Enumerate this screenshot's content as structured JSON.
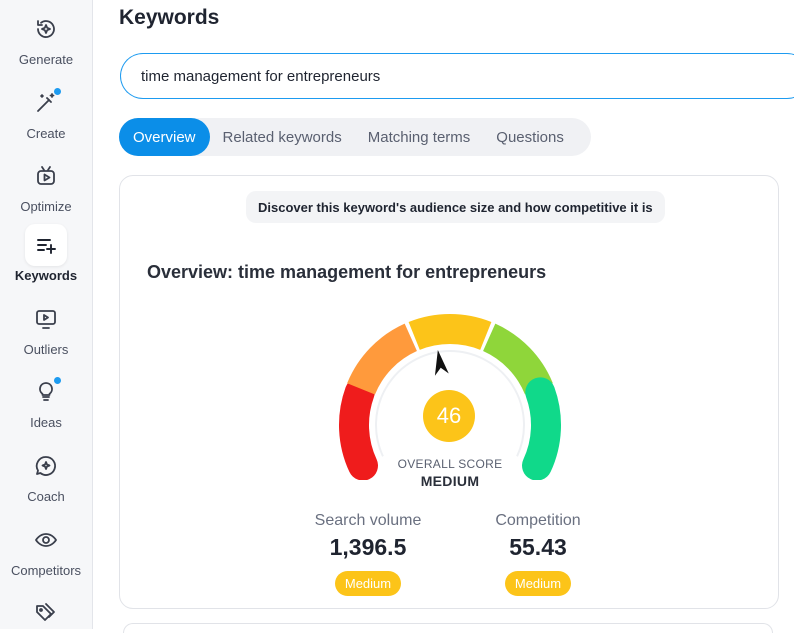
{
  "sidebar": {
    "items": [
      {
        "label": "Generate",
        "icon": "sparkle-icon",
        "dot": false,
        "active": false
      },
      {
        "label": "Create",
        "icon": "magic-wand-icon",
        "dot": true,
        "active": false
      },
      {
        "label": "Optimize",
        "icon": "video-optimize-icon",
        "dot": false,
        "active": false
      },
      {
        "label": "Keywords",
        "icon": "keywords-list-icon",
        "dot": false,
        "active": true
      },
      {
        "label": "Outliers",
        "icon": "monitor-play-icon",
        "dot": false,
        "active": false
      },
      {
        "label": "Ideas",
        "icon": "lightbulb-icon",
        "dot": true,
        "active": false
      },
      {
        "label": "Coach",
        "icon": "chat-sparkle-icon",
        "dot": false,
        "active": false
      },
      {
        "label": "Competitors",
        "icon": "eye-icon",
        "dot": false,
        "active": false
      },
      {
        "label": "",
        "icon": "tags-icon",
        "dot": false,
        "active": false
      }
    ]
  },
  "header": {
    "title": "Keywords"
  },
  "search": {
    "value": "time management for entrepreneurs",
    "placeholder": ""
  },
  "tabs": [
    {
      "label": "Overview",
      "active": true
    },
    {
      "label": "Related keywords",
      "active": false
    },
    {
      "label": "Matching terms",
      "active": false
    },
    {
      "label": "Questions",
      "active": false
    }
  ],
  "overview": {
    "hint": "Discover this keyword's audience size and how competitive it is",
    "title": "Overview: time management for entrepreneurs",
    "score": "46",
    "score_fraction": 0.46,
    "score_label": "OVERALL SCORE",
    "score_level": "MEDIUM",
    "gauge_colors": [
      "#ef1c1c",
      "#ff9a3c",
      "#fcc419",
      "#8fd63a",
      "#10d98a"
    ],
    "metrics": [
      {
        "label": "Search volume",
        "value": "1,396.5",
        "badge": "Medium"
      },
      {
        "label": "Competition",
        "value": "55.43",
        "badge": "Medium"
      }
    ],
    "badge_color": "#fcc419"
  },
  "colors": {
    "accent": "#0b8ee8",
    "notification_dot": "#1d9bf0"
  }
}
